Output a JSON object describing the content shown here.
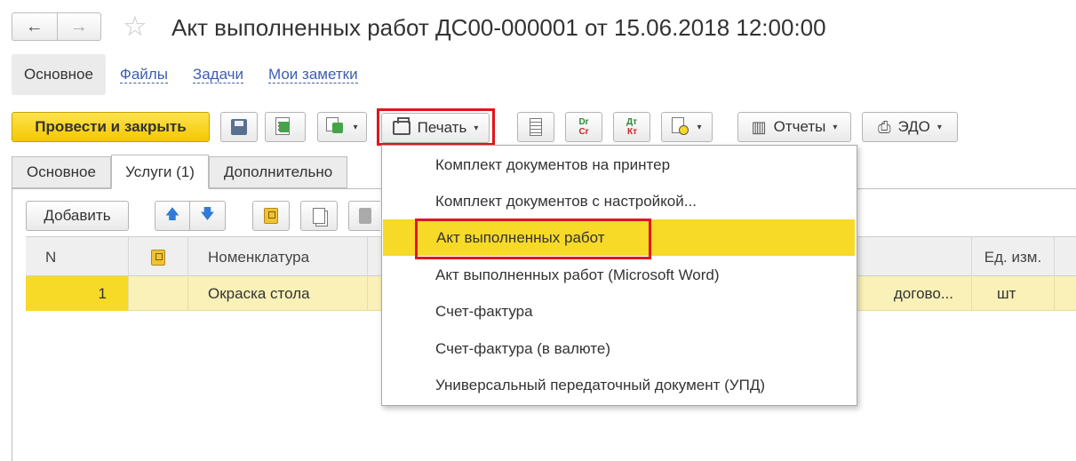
{
  "header": {
    "back_glyph": "←",
    "forward_glyph": "→",
    "star_glyph": "☆",
    "title": "Акт выполненных работ ДС00-000001 от 15.06.2018 12:00:00"
  },
  "sections": [
    {
      "label": "Основное",
      "active": true
    },
    {
      "label": "Файлы"
    },
    {
      "label": "Задачи"
    },
    {
      "label": "Мои заметки"
    }
  ],
  "toolbar": {
    "post_close": "Провести и закрыть",
    "print": "Печать",
    "reports": "Отчеты",
    "edo": "ЭДО",
    "dt_top": "Dr",
    "dt_bottom": "Cr",
    "dtkt_top": "Дт",
    "dtkt_bottom": "Кт",
    "caret": "▾",
    "reports_glyph": "▥",
    "edo_glyph": "⎙"
  },
  "form_tabs": [
    {
      "label": "Основное"
    },
    {
      "label": "Услуги (1)",
      "active": true
    },
    {
      "label": "Дополнительно"
    }
  ],
  "table_toolbar": {
    "add": "Добавить",
    "up_glyph": "🡅",
    "down_glyph": "🡇"
  },
  "table": {
    "columns": [
      "N",
      "",
      "Номенклатура",
      "",
      "Ед. изм."
    ],
    "rows": [
      {
        "n": "1",
        "name": "Окраска стола",
        "content": "догово...",
        "unit": "шт"
      }
    ]
  },
  "print_menu": {
    "items": [
      "Комплект документов на принтер",
      "Комплект документов с настройкой...",
      "Акт выполненных работ",
      "Акт выполненных работ (Microsoft Word)",
      "Счет-фактура",
      "Счет-фактура (в валюте)",
      "Универсальный передаточный документ (УПД)"
    ],
    "highlighted_index": 2
  },
  "colors": {
    "accent_yellow": "#f7d928",
    "highlight_red": "#e1161b",
    "link_blue": "#3d5eb0",
    "row_selected": "#faf1b8"
  }
}
